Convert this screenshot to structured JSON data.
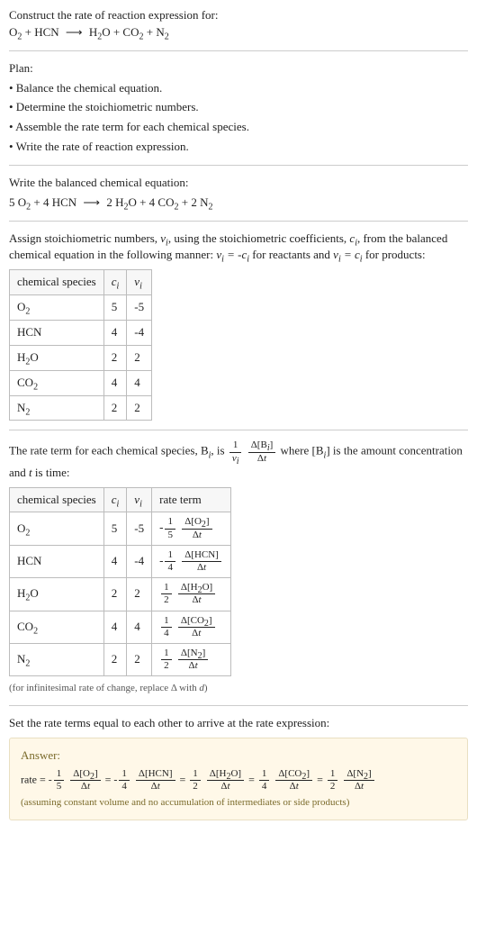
{
  "domain": "Document",
  "intro": {
    "prompt": "Construct the rate of reaction expression for:"
  },
  "plan": {
    "heading": "Plan:",
    "b1": "• Balance the chemical equation.",
    "b2": "• Determine the stoichiometric numbers.",
    "b3": "• Assemble the rate term for each chemical species.",
    "b4": "• Write the rate of reaction expression."
  },
  "balanced_heading": "Write the balanced chemical equation:",
  "stoich_text1": "Assign stoichiometric numbers, ",
  "stoich_text2": ", using the stoichiometric coefficients, ",
  "stoich_text3": ", from the balanced chemical equation in the following manner: ",
  "stoich_text4": " for reactants and ",
  "stoich_text5": " for products:",
  "table1": {
    "h1": "chemical species",
    "rows": [
      {
        "sp": "O",
        "sub": "2",
        "c": "5",
        "v": "-5"
      },
      {
        "sp": "HCN",
        "sub": "",
        "c": "4",
        "v": "-4"
      },
      {
        "sp": "H",
        "sub": "2",
        "extra": "O",
        "c": "2",
        "v": "2"
      },
      {
        "sp": "CO",
        "sub": "2",
        "c": "4",
        "v": "4"
      },
      {
        "sp": "N",
        "sub": "2",
        "c": "2",
        "v": "2"
      }
    ]
  },
  "rate_term_text1": "The rate term for each chemical species, B",
  "rate_term_text2": ", is ",
  "rate_term_text3": " where [B",
  "rate_term_text4": "] is the amount concentration and ",
  "rate_term_text5": " is time:",
  "table2": {
    "h1": "chemical species",
    "h4": "rate term"
  },
  "infinitesimal_note": "(for infinitesimal rate of change, replace Δ with d)",
  "set_equal": "Set the rate terms equal to each other to arrive at the rate expression:",
  "answer": {
    "label": "Answer:",
    "prefix": "rate = ",
    "assume": "(assuming constant volume and no accumulation of intermediates or side products)"
  },
  "symbols": {
    "nu_i": "ν",
    "c_i": "c",
    "i": "i",
    "t": "t",
    "delta": "Δ",
    "d": "d"
  },
  "chart_data": {
    "type": "table",
    "reaction_unbalanced": {
      "reactants": [
        "O2",
        "HCN"
      ],
      "products": [
        "H2O",
        "CO2",
        "N2"
      ]
    },
    "reaction_balanced": {
      "reactants": [
        {
          "coef": 5,
          "sp": "O2"
        },
        {
          "coef": 4,
          "sp": "HCN"
        }
      ],
      "products": [
        {
          "coef": 2,
          "sp": "H2O"
        },
        {
          "coef": 4,
          "sp": "CO2"
        },
        {
          "coef": 2,
          "sp": "N2"
        }
      ]
    },
    "stoichiometry_table": {
      "columns": [
        "chemical species",
        "c_i",
        "ν_i"
      ],
      "rows": [
        [
          "O2",
          5,
          -5
        ],
        [
          "HCN",
          4,
          -4
        ],
        [
          "H2O",
          2,
          2
        ],
        [
          "CO2",
          4,
          4
        ],
        [
          "N2",
          2,
          2
        ]
      ]
    },
    "rate_term_table": {
      "columns": [
        "chemical species",
        "c_i",
        "ν_i",
        "rate term"
      ],
      "rows": [
        [
          "O2",
          5,
          -5,
          "-(1/5) Δ[O2]/Δt"
        ],
        [
          "HCN",
          4,
          -4,
          "-(1/4) Δ[HCN]/Δt"
        ],
        [
          "H2O",
          2,
          2,
          "(1/2) Δ[H2O]/Δt"
        ],
        [
          "CO2",
          4,
          4,
          "(1/4) Δ[CO2]/Δt"
        ],
        [
          "N2",
          2,
          2,
          "(1/2) Δ[N2]/Δt"
        ]
      ]
    },
    "rate_expression": "rate = -(1/5) Δ[O2]/Δt = -(1/4) Δ[HCN]/Δt = (1/2) Δ[H2O]/Δt = (1/4) Δ[CO2]/Δt = (1/2) Δ[N2]/Δt"
  }
}
